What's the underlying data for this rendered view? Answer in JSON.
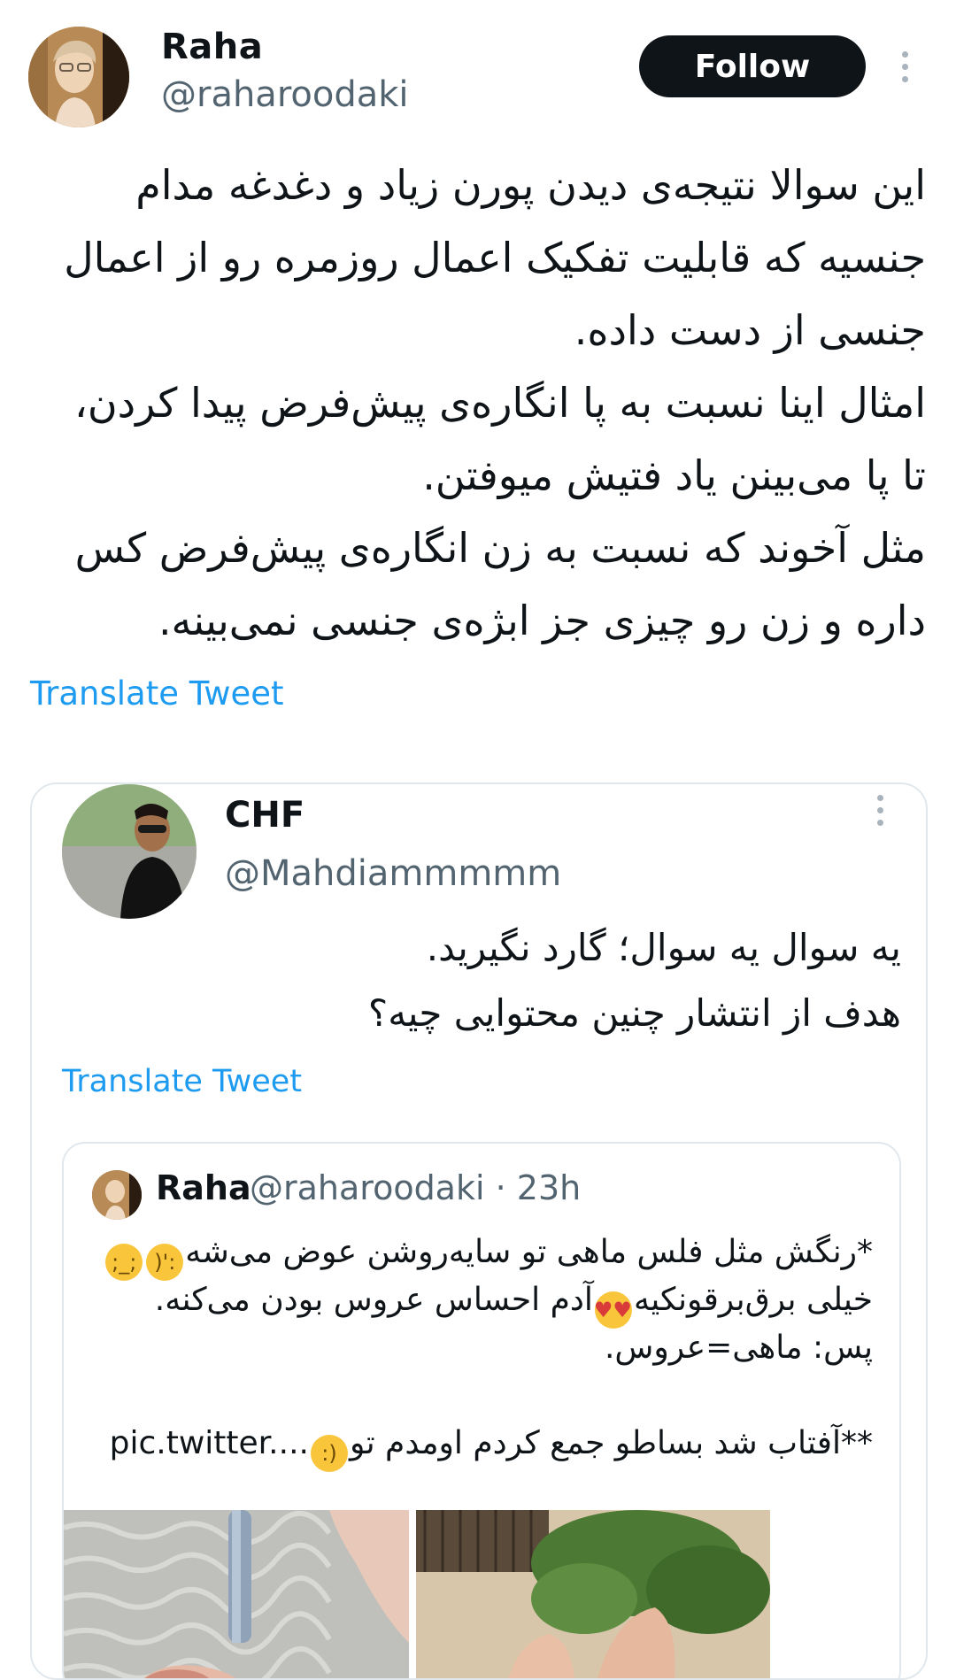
{
  "author": {
    "name": "Raha",
    "handle": "@raharoodaki",
    "follow_label": "Follow",
    "more_icon": "more-vertical-icon"
  },
  "tweet": {
    "lines": [
      "این سوالا نتیجه‌ی دیدن پورن زیاد و دغدغه مدام",
      "جنسیه که قابلیت تفکیک اعمال روزمره رو از اعمال",
      "جنسی از دست داده.",
      "امثال اینا نسبت به پا انگاره‌ی پیش‌فرض پیدا کردن،",
      "تا پا می‌بینن یاد فتیش میوفتن.",
      "مثل آخوند که نسبت به زن انگاره‌ی پیش‌فرض کس",
      "داره و زن رو چیزی جز ابژه‌ی جنسی نمی‌بینه."
    ],
    "translate_label": "Translate Tweet"
  },
  "quoted": {
    "name": "CHF",
    "handle": "@Mahdiammmmm",
    "lines": [
      "یه سوال یه سوال؛ گارد نگیرید.",
      "هدف از انتشار چنین محتوایی چیه؟"
    ],
    "translate_label": "Translate Tweet",
    "inner": {
      "name": "Raha",
      "handle": "@raharoodaki · 23h",
      "line1": "*رنگش مثل فلس ماهی تو سایه‌روشن عوض می‌شه",
      "line2a": "خیلی برق‌برقونکیه",
      "line2b": "آدم احساس عروس بودن می‌کنه.",
      "line3": "پس: ماهی=عروس.",
      "line5": "**آفتاب شد بساطو جمع کردم اومدم تو",
      "link": "pic.twitter....",
      "emojis": [
        "crying-face-emoji",
        "tearful-face-emoji",
        "heart-eyes-emoji",
        "upside-down-face-emoji"
      ]
    }
  },
  "colors": {
    "accent": "#1d9bf0",
    "text": "#0f1419",
    "secondary": "#536471",
    "button": "#0f1419",
    "border": "#e1e8ed"
  }
}
